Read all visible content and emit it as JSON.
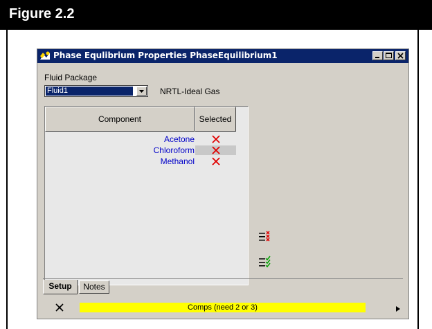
{
  "figure": {
    "title": "Figure 2.2"
  },
  "window": {
    "title": "Phase Equlibrium Properties PhaseEquilibrium1",
    "controls": [
      "minimize-icon",
      "maximize-icon",
      "close-icon"
    ]
  },
  "fluid_package": {
    "label": "Fluid Package",
    "selected": "Fluid1",
    "model": "NRTL-Ideal Gas"
  },
  "table": {
    "columns": [
      "Component",
      "Selected"
    ],
    "rows": [
      {
        "component": "Acetone",
        "selected": "x-icon"
      },
      {
        "component": "Chloroform",
        "selected": "x-icon"
      },
      {
        "component": "Methanol",
        "selected": "x-icon"
      }
    ]
  },
  "side_icons": [
    "remove-list-icon",
    "add-list-icon"
  ],
  "tabs": [
    {
      "label": "Setup",
      "active": true
    },
    {
      "label": "Notes",
      "active": false
    }
  ],
  "status": {
    "message": "Comps (need 2 or 3)",
    "color": "#ffff00"
  },
  "colors": {
    "titlebar": "#0a246a",
    "component_text": "#0000c8",
    "x_mark": "#e00000",
    "check_mark": "#00a000"
  }
}
